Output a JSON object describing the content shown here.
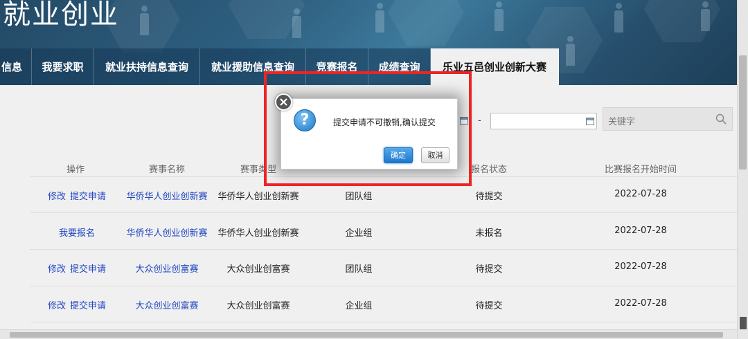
{
  "banner": {
    "title": "就业创业"
  },
  "nav": {
    "items": [
      {
        "label": "信息"
      },
      {
        "label": "我要求职"
      },
      {
        "label": "就业扶持信息查询"
      },
      {
        "label": "就业援助信息查询"
      },
      {
        "label": "竞赛报名"
      },
      {
        "label": "成绩查询"
      },
      {
        "label": "乐业五邑创业创新大赛"
      }
    ],
    "active_index": 6
  },
  "search": {
    "date_separator": "-",
    "keyword_placeholder": "关键字"
  },
  "table": {
    "headers": {
      "action": "操作",
      "name": "赛事名称",
      "type": "赛事类型",
      "status": "报名状态",
      "start_time": "比赛报名开始时间"
    },
    "rows": [
      {
        "actions": [
          "修改",
          "提交申请"
        ],
        "name": "华侨华人创业创新赛",
        "type": "华侨华人创业创新赛",
        "group": "团队组",
        "status": "待提交",
        "start_time": "2022-07-28"
      },
      {
        "actions": [
          "我要报名"
        ],
        "name": "华侨华人创业创新赛",
        "type": "华侨华人创业创新赛",
        "group": "企业组",
        "status": "未报名",
        "start_time": "2022-07-28"
      },
      {
        "actions": [
          "修改",
          "提交申请"
        ],
        "name": "大众创业创富赛",
        "type": "大众创业创富赛",
        "group": "团队组",
        "status": "待提交",
        "start_time": "2022-07-28"
      },
      {
        "actions": [
          "修改",
          "提交申请"
        ],
        "name": "大众创业创富赛",
        "type": "大众创业创富赛",
        "group": "企业组",
        "status": "待提交",
        "start_time": "2022-07-28"
      }
    ]
  },
  "dialog": {
    "message": "提交申请不可撤销,确认提交",
    "confirm_label": "确定",
    "cancel_label": "取消",
    "question_glyph": "?"
  },
  "colors": {
    "highlight": "#ee2424",
    "link": "#2146c2",
    "banner": "#2e5f80"
  }
}
